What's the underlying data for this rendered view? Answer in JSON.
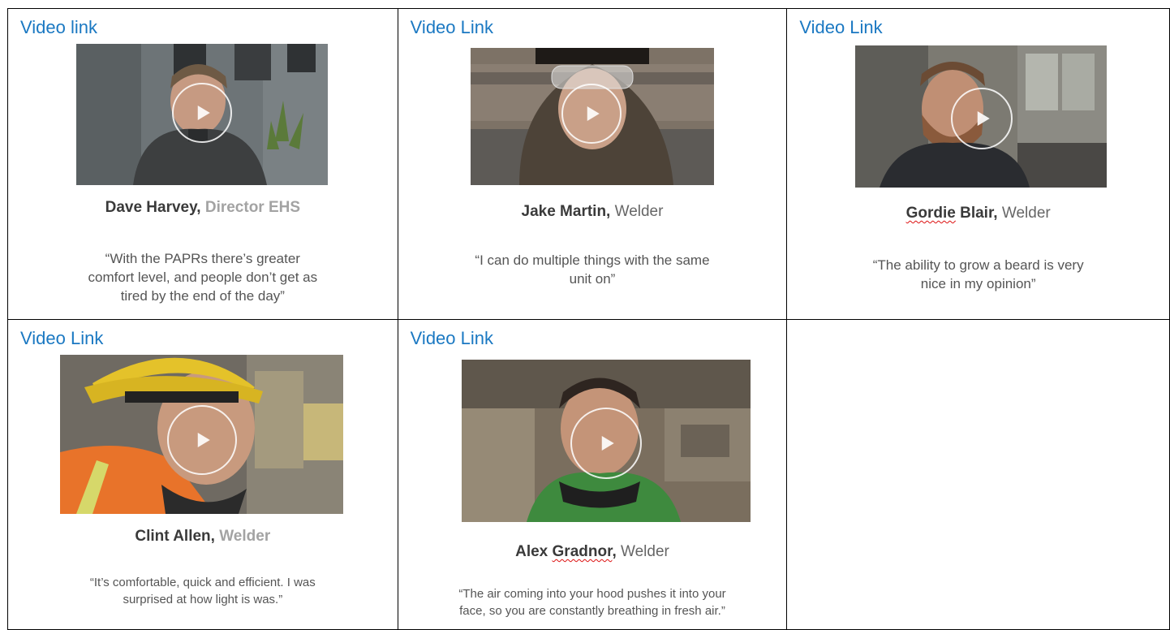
{
  "cards": [
    {
      "link": "Video link",
      "name": "Dave Harvey,",
      "role": "Director EHS",
      "quote": "“With the PAPRs there’s greater comfort level, and people don’t get as tired by the end of the day”",
      "icon": "play-icon"
    },
    {
      "link": "Video Link",
      "name": "Jake Martin,",
      "role": "Welder",
      "quote": "“I can do multiple things with the same unit on”",
      "icon": "play-icon"
    },
    {
      "link": "Video Link",
      "name_first": "Gordie",
      "name_last": "Blair,",
      "role": "Welder",
      "quote": "“The ability to grow a beard is very nice in my opinion”",
      "icon": "play-icon"
    },
    {
      "link": "Video Link",
      "name": "Clint Allen,",
      "role": "Welder",
      "quote": "“It’s comfortable, quick and efficient. I was surprised at how light is was.”",
      "icon": "play-icon"
    },
    {
      "link": "Video Link",
      "name_first": "Alex",
      "name_last": "Gradnor",
      "name_comma": ",",
      "role": "Welder",
      "quote": "“The air coming into your hood pushes it into your face, so you are constantly breathing in fresh air.”",
      "icon": "play-icon"
    }
  ]
}
